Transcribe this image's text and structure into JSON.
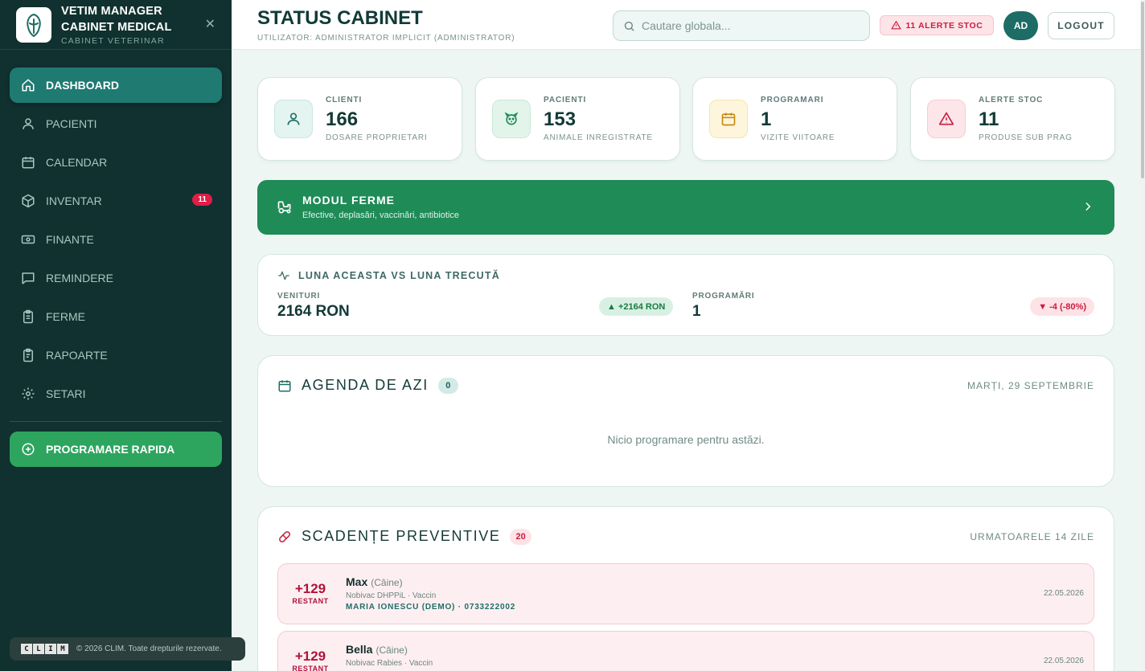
{
  "brand": {
    "title_line1": "VETIM MANAGER",
    "title_line2": "CABINET MEDICAL",
    "subtitle": "CABINET VETERINAR"
  },
  "sidebar": {
    "items": [
      {
        "label": "DASHBOARD",
        "icon": "home-icon",
        "active": true
      },
      {
        "label": "PACIENTI",
        "icon": "user-icon"
      },
      {
        "label": "CALENDAR",
        "icon": "calendar-icon"
      },
      {
        "label": "INVENTAR",
        "icon": "box-icon",
        "badge": "11"
      },
      {
        "label": "FINANTE",
        "icon": "money-icon"
      },
      {
        "label": "REMINDERE",
        "icon": "message-icon"
      },
      {
        "label": "FERME",
        "icon": "clipboard-icon"
      },
      {
        "label": "RAPOARTE",
        "icon": "report-icon"
      },
      {
        "label": "SETARI",
        "icon": "gear-icon"
      }
    ],
    "quick_action": "PROGRAMARE RAPIDA",
    "footer_logo": [
      "C",
      "L",
      "I",
      "M"
    ],
    "footer": "© 2026 CLIM. Toate drepturile rezervate."
  },
  "header": {
    "title": "STATUS CABINET",
    "subtitle": "UTILIZATOR: ADMINISTRATOR IMPLICIT (ADMINISTRATOR)",
    "search_placeholder": "Cautare globala...",
    "stock_alert": "11 ALERTE STOC",
    "avatar": "AD",
    "logout": "LOGOUT"
  },
  "stats": [
    {
      "label": "CLIENTI",
      "value": "166",
      "sub": "DOSARE PROPRIETARI",
      "icon": "user-icon",
      "bg": "#e4f4f1",
      "color": "#1f6e66"
    },
    {
      "label": "PACIENTI",
      "value": "153",
      "sub": "ANIMALE INREGISTRATE",
      "icon": "pet-icon",
      "bg": "#e3f5ea",
      "color": "#1f8b57"
    },
    {
      "label": "PROGRAMARI",
      "value": "1",
      "sub": "VIZITE VIITOARE",
      "icon": "calendar-icon",
      "bg": "#fdf6dd",
      "color": "#c98a10"
    },
    {
      "label": "ALERTE STOC",
      "value": "11",
      "sub": "PRODUSE SUB PRAG",
      "icon": "warning-icon",
      "bg": "#fde6ea",
      "color": "#c81e3f"
    }
  ],
  "farm_module": {
    "title": "MODUL FERME",
    "subtitle": "Efective, deplasări, vaccinări, antibiotice"
  },
  "comparison": {
    "title": "LUNA ACEASTA VS LUNA TRECUTĂ",
    "revenue_label": "VENITURI",
    "revenue_value": "2164 RON",
    "revenue_delta": "▲ +2164 RON",
    "appointments_label": "PROGRAMĂRI",
    "appointments_value": "1",
    "appointments_delta": "▼ -4 (-80%)"
  },
  "agenda": {
    "title": "AGENDA DE AZI",
    "count": "0",
    "date": "MARȚI, 29 SEPTEMBRIE",
    "empty": "Nicio programare pentru astăzi."
  },
  "due": {
    "title": "SCADENȚE PREVENTIVE",
    "count": "20",
    "range": "URMATOARELE 14 ZILE",
    "items": [
      {
        "days": "+129",
        "status": "RESTANT",
        "name": "Max",
        "species": "(Câine)",
        "desc": "Nobivac DHPPiL · Vaccin",
        "owner": "MARIA IONESCU (DEMO) · 0733222002",
        "date": "22.05.2026"
      },
      {
        "days": "+129",
        "status": "RESTANT",
        "name": "Bella",
        "species": "(Câine)",
        "desc": "Nobivac Rabies · Vaccin",
        "owner": "",
        "date": "22.05.2026"
      }
    ]
  }
}
